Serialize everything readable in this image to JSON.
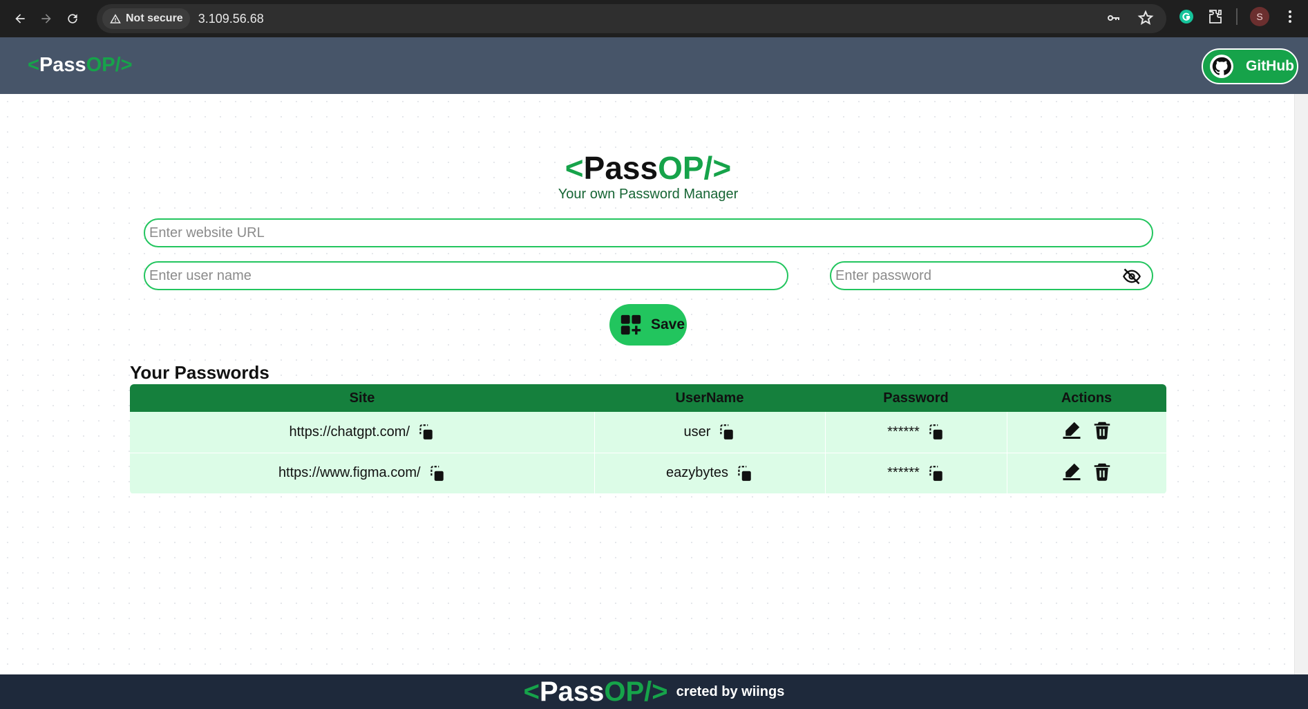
{
  "browser": {
    "security_label": "Not secure",
    "url": "3.109.56.68",
    "profile_initial": "S"
  },
  "navbar": {
    "logo": {
      "open": "<",
      "pass": "Pass",
      "op": "OP/>"
    },
    "github_label": "GitHub"
  },
  "hero": {
    "title": {
      "open": "<",
      "pass": "Pass",
      "op": "OP/>"
    },
    "subtitle": "Your own Password Manager"
  },
  "form": {
    "url_placeholder": "Enter website URL",
    "url_value": "",
    "username_placeholder": "Enter user name",
    "username_value": "",
    "password_placeholder": "Enter password",
    "password_value": "",
    "save_label": "Save"
  },
  "passwords": {
    "section_title": "Your Passwords",
    "columns": [
      "Site",
      "UserName",
      "Password",
      "Actions"
    ],
    "rows": [
      {
        "site": "https://chatgpt.com/",
        "username": "user",
        "password": "******"
      },
      {
        "site": "https://www.figma.com/",
        "username": "eazybytes",
        "password": "******"
      }
    ]
  },
  "footer": {
    "logo": {
      "open": "<",
      "pass": "Pass",
      "op": "OP/>"
    },
    "credit": "creted by wiings"
  },
  "colors": {
    "brand_green": "#16a34a",
    "navbar_bg": "#475569",
    "footer_bg": "#1e293b",
    "table_header": "#15803d",
    "table_row": "#dcfce7"
  }
}
